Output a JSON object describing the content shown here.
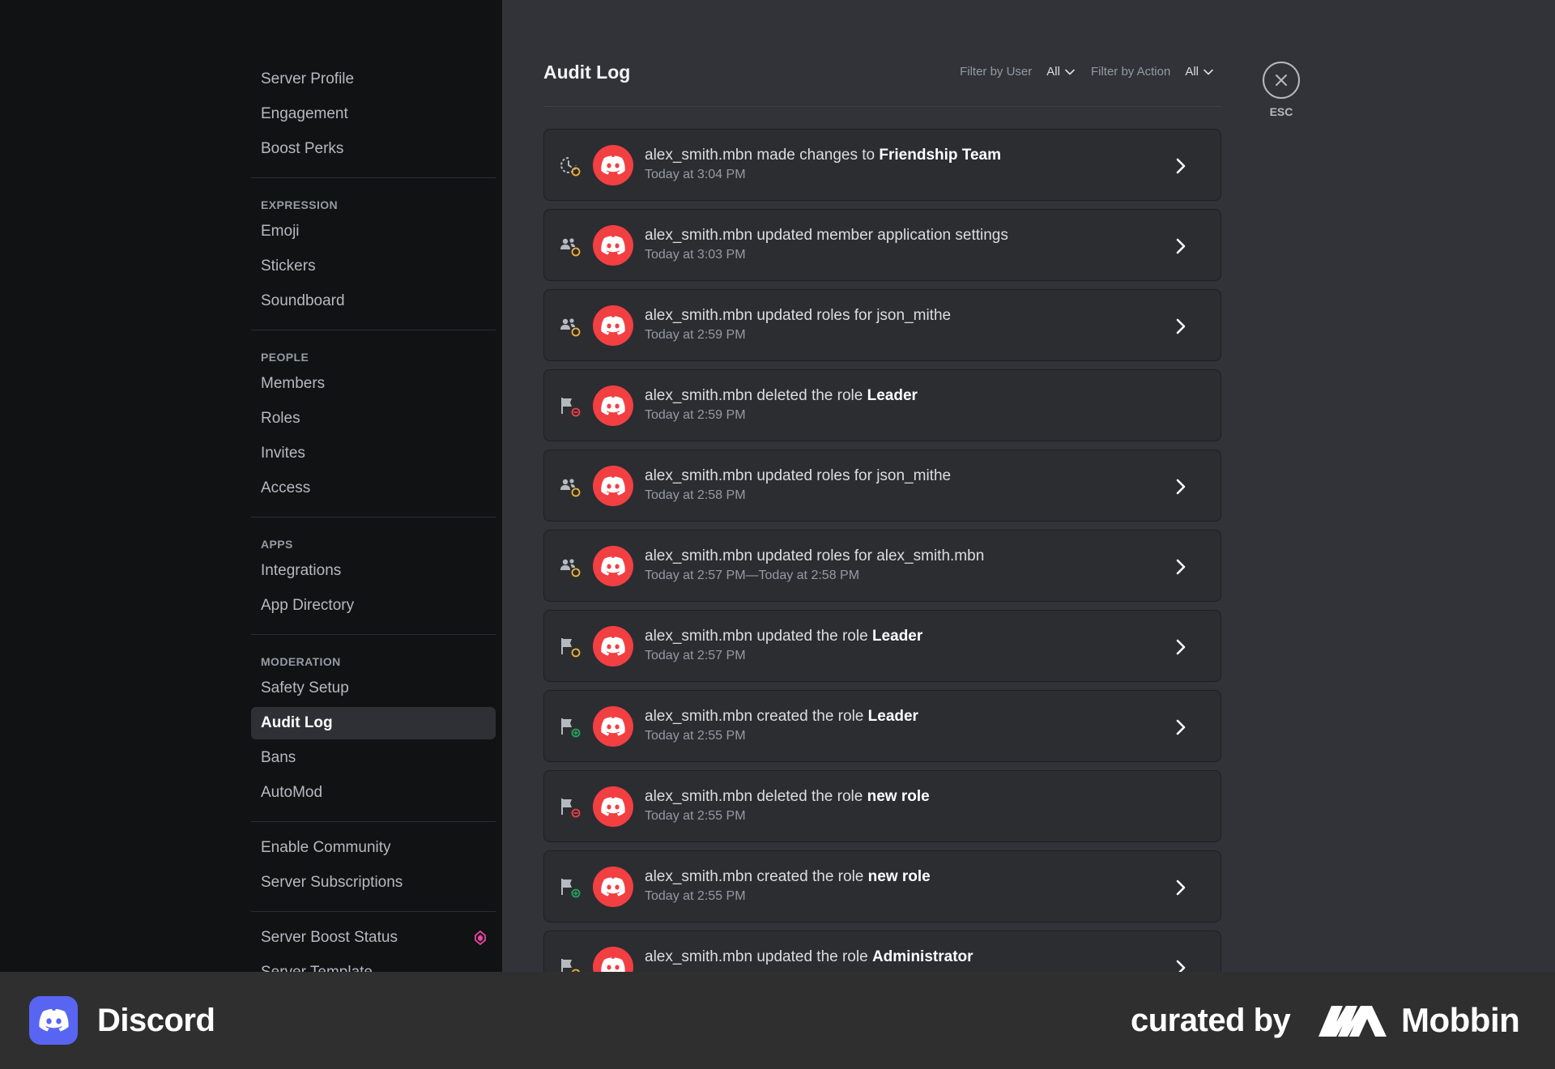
{
  "sidebar": {
    "groups": [
      {
        "header": "",
        "items": [
          "Server Profile",
          "Engagement",
          "Boost Perks"
        ]
      },
      {
        "header": "EXPRESSION",
        "items": [
          "Emoji",
          "Stickers",
          "Soundboard"
        ]
      },
      {
        "header": "PEOPLE",
        "items": [
          "Members",
          "Roles",
          "Invites",
          "Access"
        ]
      },
      {
        "header": "APPS",
        "items": [
          "Integrations",
          "App Directory"
        ]
      },
      {
        "header": "MODERATION",
        "items": [
          "Safety Setup",
          "Audit Log",
          "Bans",
          "AutoMod"
        ]
      },
      {
        "header": "",
        "items": [
          "Enable Community",
          "Server Subscriptions"
        ]
      },
      {
        "header": "",
        "items": [
          "Server Boost Status",
          "Server Template"
        ]
      }
    ],
    "active_item": "Audit Log",
    "boost_icon": "gem-icon"
  },
  "main": {
    "title": "Audit Log",
    "filter_user_label": "Filter by User",
    "filter_user_value": "All",
    "filter_action_label": "Filter by Action",
    "filter_action_value": "All",
    "esc_label": "ESC"
  },
  "entries": [
    {
      "icon": "server-update-icon",
      "prefix": "alex_smith.mbn made changes to ",
      "target": "Friendship Team",
      "time": "Today at 3:04 PM",
      "expandable": true
    },
    {
      "icon": "member-update-icon",
      "prefix": "alex_smith.mbn updated member application settings",
      "target": "",
      "time": "Today at 3:03 PM",
      "expandable": true
    },
    {
      "icon": "member-update-icon",
      "prefix": "alex_smith.mbn updated roles for json_mithe",
      "target": "",
      "time": "Today at 2:59 PM",
      "expandable": true
    },
    {
      "icon": "role-delete-icon",
      "prefix": "alex_smith.mbn deleted the role ",
      "target": "Leader",
      "time": "Today at 2:59 PM",
      "expandable": false
    },
    {
      "icon": "member-update-icon",
      "prefix": "alex_smith.mbn updated roles for json_mithe",
      "target": "",
      "time": "Today at 2:58 PM",
      "expandable": true
    },
    {
      "icon": "member-update-icon",
      "prefix": "alex_smith.mbn updated roles for alex_smith.mbn",
      "target": "",
      "time": "Today at 2:57 PM—Today at 2:58 PM",
      "expandable": true
    },
    {
      "icon": "role-update-icon",
      "prefix": "alex_smith.mbn updated the role ",
      "target": "Leader",
      "time": "Today at 2:57 PM",
      "expandable": true
    },
    {
      "icon": "role-create-icon",
      "prefix": "alex_smith.mbn created the role ",
      "target": "Leader",
      "time": "Today at 2:55 PM",
      "expandable": true
    },
    {
      "icon": "role-delete-icon",
      "prefix": "alex_smith.mbn deleted the role ",
      "target": "new role",
      "time": "Today at 2:55 PM",
      "expandable": false
    },
    {
      "icon": "role-create-icon",
      "prefix": "alex_smith.mbn created the role ",
      "target": "new role",
      "time": "Today at 2:55 PM",
      "expandable": true
    },
    {
      "icon": "role-update-icon",
      "prefix": "alex_smith.mbn updated the role ",
      "target": "Administrator",
      "time": "",
      "expandable": true
    }
  ],
  "footer": {
    "app_name": "Discord",
    "curated_by": "curated by",
    "curator": "Mobbin"
  },
  "colors": {
    "avatar": "#f23f42",
    "update_badge": "#f0b232",
    "delete_badge": "#f23f42",
    "create_badge": "#23a55a",
    "brand": "#5865f2",
    "boost": "#eb459f"
  }
}
